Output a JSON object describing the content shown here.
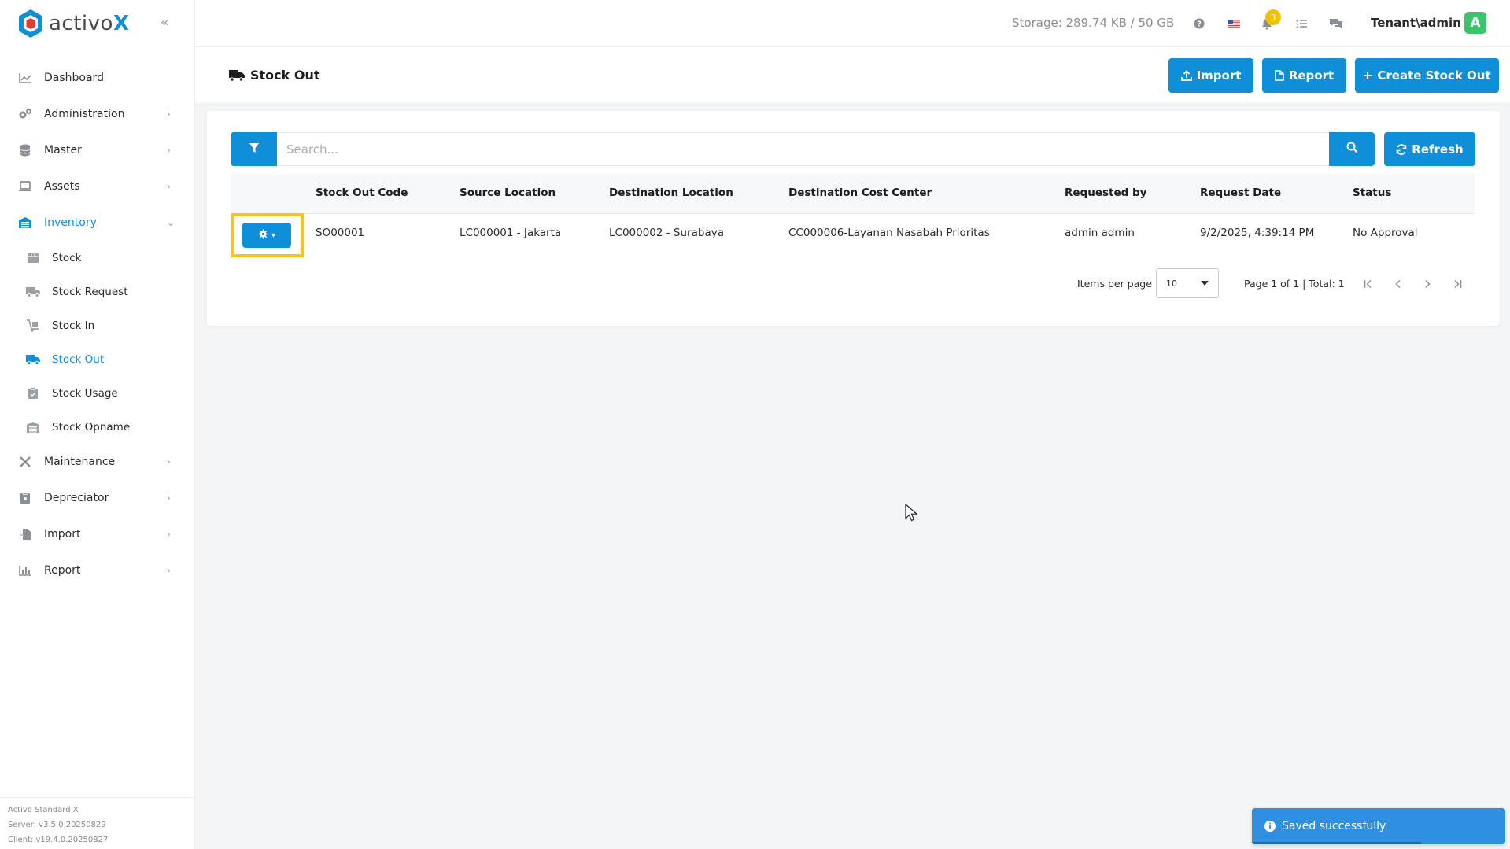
{
  "brand": {
    "name": "activo",
    "suffix": "X"
  },
  "sidebar": {
    "items": [
      {
        "label": "Dashboard",
        "icon": "chart-line-icon"
      },
      {
        "label": "Administration",
        "icon": "gears-icon"
      },
      {
        "label": "Master",
        "icon": "database-icon"
      },
      {
        "label": "Assets",
        "icon": "laptop-icon"
      },
      {
        "label": "Inventory",
        "icon": "warehouse-icon"
      },
      {
        "label": "Maintenance",
        "icon": "tools-icon"
      },
      {
        "label": "Depreciator",
        "icon": "clipboard-icon"
      },
      {
        "label": "Import",
        "icon": "file-import-icon"
      },
      {
        "label": "Report",
        "icon": "bar-chart-icon"
      }
    ],
    "inventory_sub": [
      {
        "label": "Stock",
        "icon": "box-icon"
      },
      {
        "label": "Stock Request",
        "icon": "truck-icon"
      },
      {
        "label": "Stock In",
        "icon": "dolly-icon"
      },
      {
        "label": "Stock Out",
        "icon": "truck-moving-icon"
      },
      {
        "label": "Stock Usage",
        "icon": "clipboard-check-icon"
      },
      {
        "label": "Stock Opname",
        "icon": "warehouse-icon"
      }
    ],
    "footer": {
      "line1": "Activo Standard X",
      "line2": "Server: v3.5.0.20250829",
      "line3": "Client: v19.4.0.20250827"
    }
  },
  "topbar": {
    "storage": "Storage: 289.74 KB / 50 GB",
    "notification_count": "3",
    "tenant": "Tenant\\admin",
    "avatar_letter": "A"
  },
  "page": {
    "title": "Stock Out",
    "buttons": {
      "import": "Import",
      "report": "Report",
      "create": "Create Stock Out"
    }
  },
  "search": {
    "placeholder": "Search...",
    "refresh_label": "Refresh"
  },
  "table": {
    "headers": [
      "Stock Out Code",
      "Source Location",
      "Destination Location",
      "Destination Cost Center",
      "Requested by",
      "Request Date",
      "Status"
    ],
    "rows": [
      {
        "code": "SO00001",
        "source": "LC000001 - Jakarta",
        "destination": "LC000002 - Surabaya",
        "cost_center": "CC000006-Layanan Nasabah Prioritas",
        "requested_by": "admin admin",
        "request_date": "9/2/2025, 4:39:14 PM",
        "status": "No Approval"
      }
    ]
  },
  "pager": {
    "items_per_page_label": "Items per page",
    "items_per_page": "10",
    "page_info": "Page 1 of 1 | Total: 1"
  },
  "toast": {
    "message": "Saved successfully."
  },
  "colors": {
    "primary": "#0f8fd8",
    "highlight": "#f5c518",
    "toast": "#2f8fe0",
    "avatar": "#3cc46b",
    "badge": "#f2c200"
  }
}
